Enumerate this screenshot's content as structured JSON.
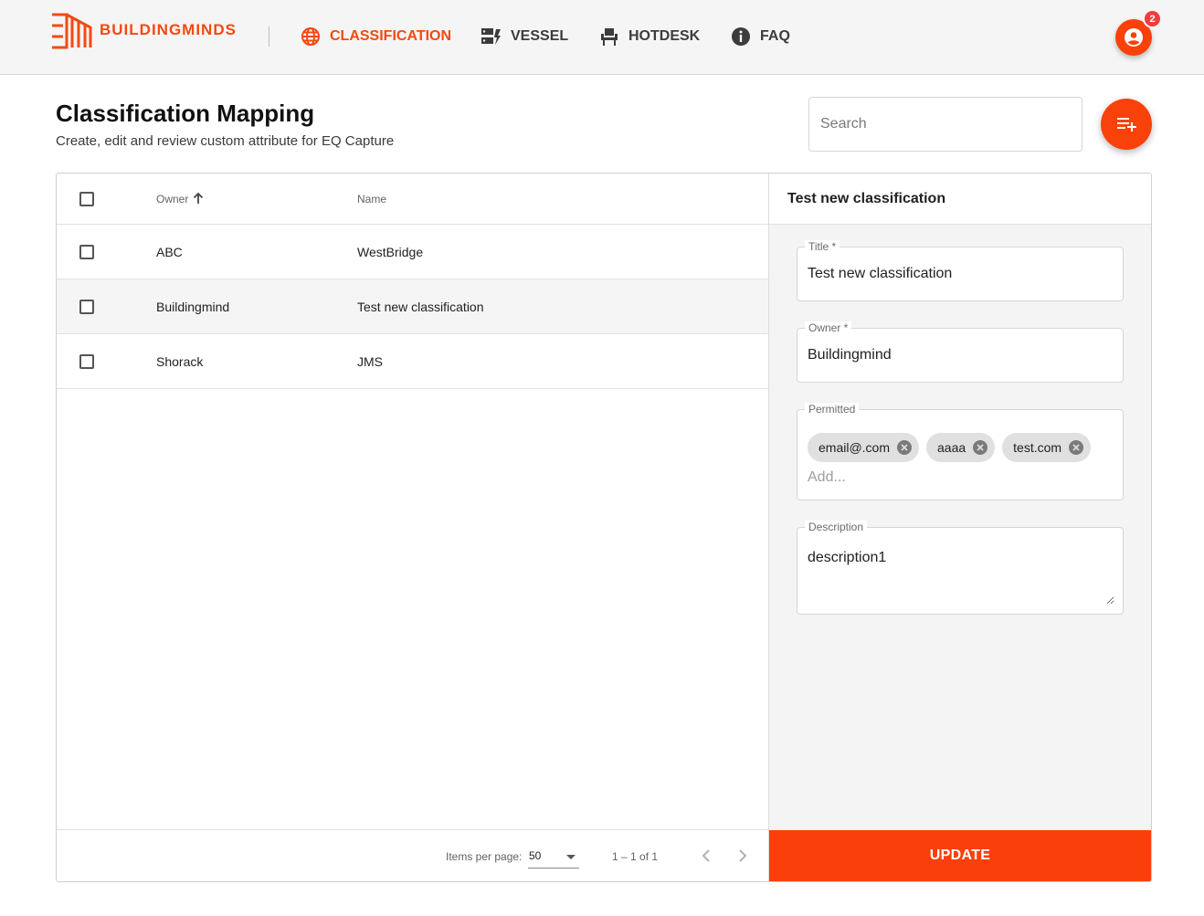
{
  "app": {
    "brand": "BUILDINGMINDS",
    "nav": [
      {
        "label": "CLASSIFICATION",
        "icon": "globe-icon",
        "active": true
      },
      {
        "label": "VESSEL",
        "icon": "vessel-icon",
        "active": false
      },
      {
        "label": "HOTDESK",
        "icon": "desk-chair-icon",
        "active": false
      },
      {
        "label": "FAQ",
        "icon": "info-icon",
        "active": false
      }
    ],
    "notifications_count": "2",
    "accent_color": "#f9410a"
  },
  "header": {
    "title": "Classification Mapping",
    "subtitle": "Create, edit and review custom attribute for EQ Capture",
    "search_placeholder": "Search"
  },
  "table": {
    "columns": [
      "Owner",
      "Name"
    ],
    "sort": {
      "column": "Owner",
      "direction": "asc"
    },
    "rows": [
      {
        "owner": "ABC",
        "name": "WestBridge",
        "selected": false
      },
      {
        "owner": "Buildingmind",
        "name": "Test new classification",
        "selected": true
      },
      {
        "owner": "Shorack",
        "name": "JMS",
        "selected": false
      }
    ],
    "paginator": {
      "items_per_page_label": "Items per page:",
      "items_per_page": "50",
      "range": "1 – 1 of 1"
    }
  },
  "detail": {
    "heading": "Test new classification",
    "title_label": "Title *",
    "title_value": "Test new classification",
    "owner_label": "Owner *",
    "owner_value": "Buildingmind",
    "permitted_label": "Permitted",
    "permitted": [
      "email@.com",
      "aaaa",
      "test.com"
    ],
    "permitted_placeholder": "Add...",
    "description_label": "Description",
    "description_value": "description1",
    "update_label": "UPDATE"
  }
}
